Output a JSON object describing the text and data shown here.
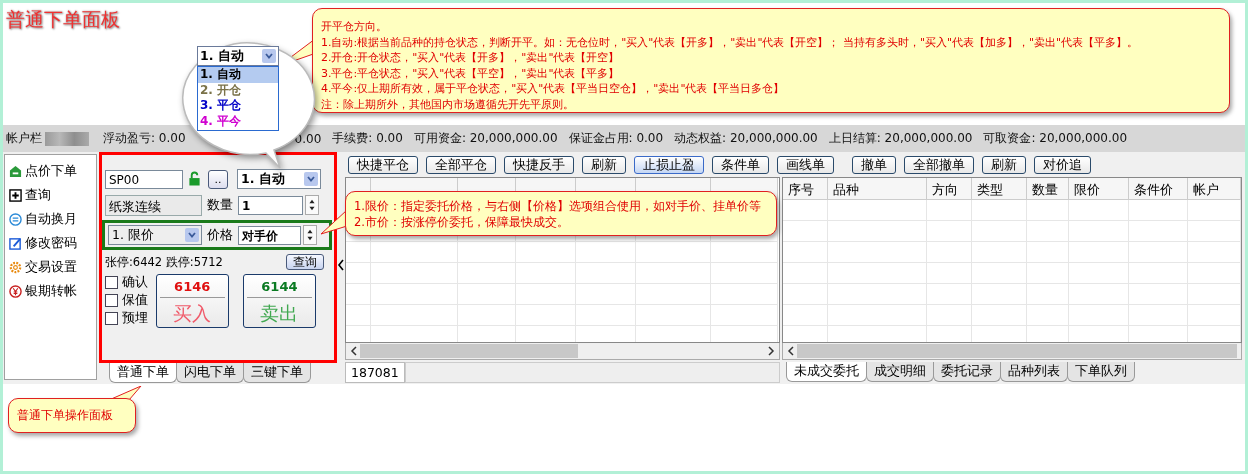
{
  "title": "普通下单面板",
  "mode_callout": {
    "lines": [
      "开平仓方向。",
      "1.自动:根据当前品种的持仓状态，判断开平。如：无仓位时，\"买入\"代表【开多】，\"卖出\"代表【开空】； 当持有多头时，\"买入\"代表【加多】，\"卖出\"代表【平多】。",
      "2.开仓:开仓状态，\"买入\"代表【开多】，\"卖出\"代表【开空】",
      "3.平仓:平仓状态，\"买入\"代表【平空】，\"卖出\"代表【平多】",
      "4.平今:仅上期所有效，属于平仓状态，\"买入\"代表【平当日空仓】，\"卖出\"代表【平当日多仓】",
      "注：除上期所外，其他国内市场遵循先开先平原则。"
    ]
  },
  "magnifier": {
    "value": "1. 自动",
    "options": [
      {
        "label": "1. 自动",
        "color": "#000000",
        "selected": true
      },
      {
        "label": "2. 开仓",
        "color": "#7a7248",
        "selected": false
      },
      {
        "label": "3. 平仓",
        "color": "#0000c8",
        "selected": false
      },
      {
        "label": "4. 平今",
        "color": "#d000d0",
        "selected": false
      }
    ]
  },
  "account_bar": {
    "label": "帐户栏",
    "stats": [
      "浮动盈亏: 0.00",
      "0.00",
      "手续费: 0.00",
      "可用资金: 20,000,000.00",
      "保证金占用: 0.00",
      "动态权益: 20,000,000.00",
      "上日结算: 20,000,000.00",
      "可取资金: 20,000,000.00"
    ]
  },
  "nav": [
    "点价下单",
    "查询",
    "自动换月",
    "修改密码",
    "交易设置",
    "银期转帐"
  ],
  "order_panel": {
    "symbol": "SP00",
    "more_button": "..",
    "direction": "1. 自动",
    "contract": "纸浆连续",
    "qty_label": "数量",
    "qty": "1",
    "price_type": "1. 限价",
    "price_label": "价格",
    "price": "对手价",
    "limits": "张停:6442 跌停:5712",
    "query": "查询",
    "options": [
      {
        "label": "确认",
        "checked": false
      },
      {
        "label": "保值",
        "checked": false
      },
      {
        "label": "预埋",
        "checked": false
      }
    ],
    "buy": {
      "price": "6146",
      "label": "买入"
    },
    "sell": {
      "price": "6144",
      "label": "卖出"
    }
  },
  "order_tabs": [
    {
      "label": "普通下单",
      "selected": true
    },
    {
      "label": "闪电下单",
      "selected": false
    },
    {
      "label": "三键下单",
      "selected": false
    }
  ],
  "toolbar": {
    "position_buttons": [
      {
        "label": "快捷平仓",
        "selected": false
      },
      {
        "label": "全部平仓",
        "selected": false
      },
      {
        "label": "快捷反手",
        "selected": false
      },
      {
        "label": "刷新",
        "selected": false
      },
      {
        "label": "止损止盈",
        "selected": true
      },
      {
        "label": "条件单",
        "selected": false
      },
      {
        "label": "画线单",
        "selected": false
      }
    ],
    "order_buttons": [
      {
        "label": "撤单",
        "selected": false
      },
      {
        "label": "全部撤单",
        "selected": false
      },
      {
        "label": "刷新",
        "selected": false
      },
      {
        "label": "对价追",
        "selected": false
      }
    ]
  },
  "positions": {
    "footer": "187081"
  },
  "orders": {
    "columns": [
      "序号",
      "品种",
      "方向",
      "类型",
      "数量",
      "限价",
      "条件价",
      "帐户"
    ],
    "tabs": [
      {
        "label": "未成交委托",
        "selected": true
      },
      {
        "label": "成交明细",
        "selected": false
      },
      {
        "label": "委托记录",
        "selected": false
      },
      {
        "label": "品种列表",
        "selected": false
      },
      {
        "label": "下单队列",
        "selected": false
      }
    ]
  },
  "price_callout": {
    "lines": [
      "1.限价：指定委托价格，与右侧【价格】选项组合使用，如对手价、挂单价等",
      "2.市价：按涨停价委托，保障最快成交。"
    ]
  },
  "panel_callout": "普通下单操作面板"
}
